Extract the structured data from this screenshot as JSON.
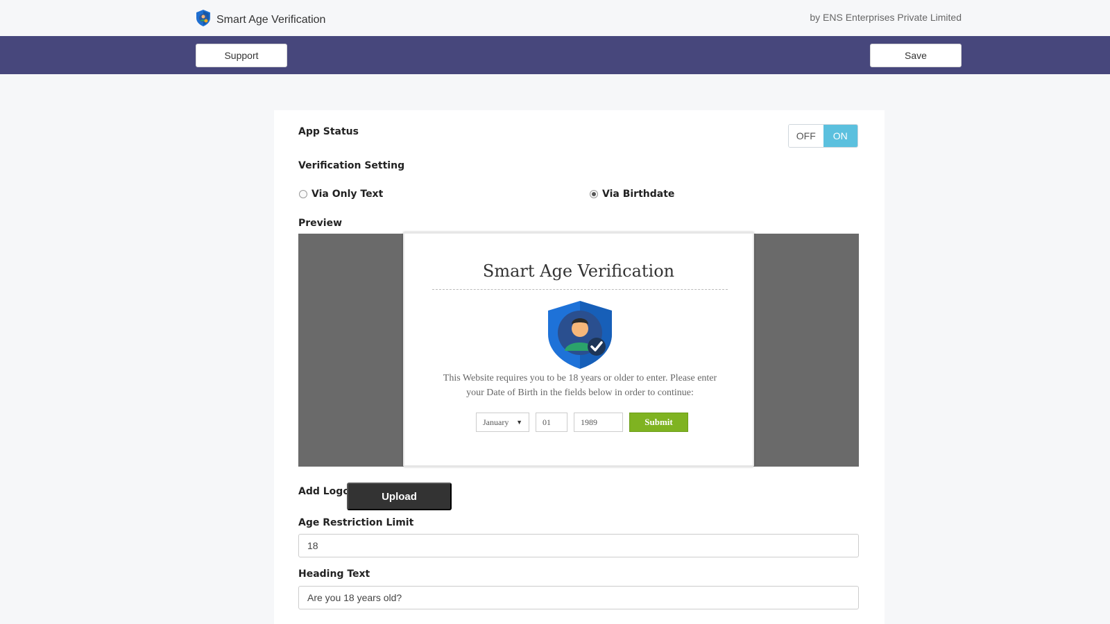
{
  "header": {
    "app_title": "Smart Age Verification",
    "byline": "by ENS Enterprises Private Limited",
    "logo_icon": "shield-icon"
  },
  "toolbar": {
    "support_label": "Support",
    "save_label": "Save"
  },
  "settings": {
    "app_status": {
      "label": "App Status",
      "off_label": "OFF",
      "on_label": "ON",
      "selected": "ON"
    },
    "verification": {
      "label": "Verification Setting",
      "options": [
        {
          "label": "Via Only Text",
          "checked": false
        },
        {
          "label": "Via Birthdate",
          "checked": true
        }
      ]
    },
    "preview": {
      "label": "Preview",
      "modal_title": "Smart Age Verification",
      "modal_text": "This Website requires you to be 18 years or older to enter. Please enter your Date of Birth in the fields below in order to continue:",
      "month": "January",
      "day": "01",
      "year": "1989",
      "submit_label": "Submit"
    },
    "logo": {
      "label": "Add Logo",
      "upload_label": "Upload"
    },
    "age_limit": {
      "label": "Age Restriction Limit",
      "value": "18"
    },
    "heading_text": {
      "label": "Heading Text",
      "value": "Are you 18 years old?"
    }
  },
  "colors": {
    "navbar": "#47477c",
    "toggle_on": "#5bc0de",
    "submit": "#7fb321",
    "upload": "#333333"
  }
}
